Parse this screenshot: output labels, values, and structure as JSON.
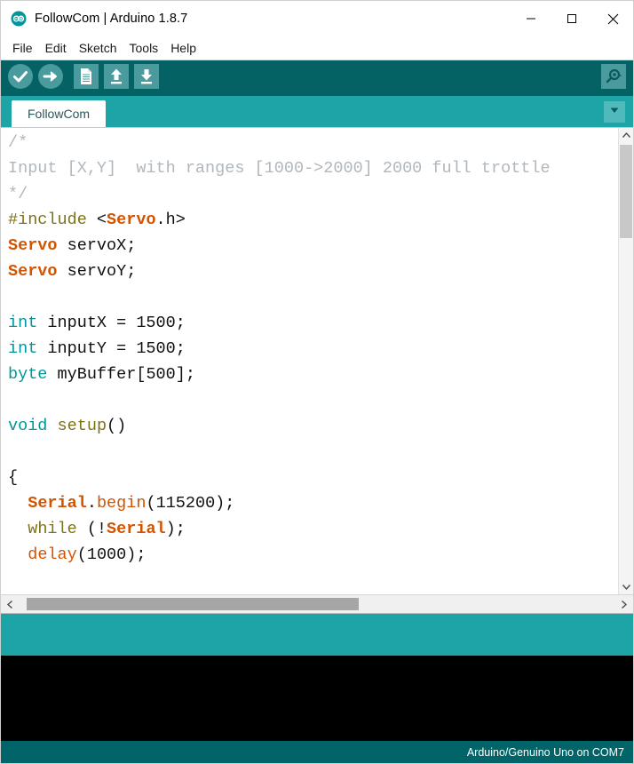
{
  "window": {
    "title": "FollowCom | Arduino 1.8.7",
    "logo_icon": "arduino-logo-icon",
    "minimize_icon": "minimize-icon",
    "maximize_icon": "maximize-icon",
    "close_icon": "close-icon"
  },
  "menubar": {
    "items": [
      {
        "label": "File"
      },
      {
        "label": "Edit"
      },
      {
        "label": "Sketch"
      },
      {
        "label": "Tools"
      },
      {
        "label": "Help"
      }
    ]
  },
  "toolbar": {
    "buttons": [
      {
        "name": "verify-button",
        "icon": "checkmark-circle-icon",
        "tooltip": "Verify"
      },
      {
        "name": "upload-button",
        "icon": "arrow-right-circle-icon",
        "tooltip": "Upload"
      },
      {
        "name": "new-button",
        "icon": "new-document-icon",
        "tooltip": "New"
      },
      {
        "name": "open-button",
        "icon": "arrow-up-icon",
        "tooltip": "Open"
      },
      {
        "name": "save-button",
        "icon": "arrow-down-icon",
        "tooltip": "Save"
      }
    ],
    "serial_monitor": {
      "icon": "magnifier-icon",
      "tooltip": "Serial Monitor"
    },
    "background_color": "#046264"
  },
  "tabbar": {
    "tabs": [
      {
        "label": "FollowCom",
        "active": true
      }
    ],
    "menu_icon": "chevron-down-icon",
    "background_color": "#1CA4A6"
  },
  "editor": {
    "lines": [
      [
        {
          "t": "/*",
          "c": "comment"
        }
      ],
      [
        {
          "t": "Input [X,Y]  with ranges [1000->2000] 2000 full trottle",
          "c": "comment"
        }
      ],
      [
        {
          "t": "*/",
          "c": "comment"
        }
      ],
      [
        {
          "t": "#include ",
          "c": "pre"
        },
        {
          "t": "<",
          "c": "plain"
        },
        {
          "t": "Servo",
          "c": "class"
        },
        {
          "t": ".h>",
          "c": "plain"
        }
      ],
      [
        {
          "t": "Servo",
          "c": "class"
        },
        {
          "t": " servoX;",
          "c": "plain"
        }
      ],
      [
        {
          "t": "Servo",
          "c": "class"
        },
        {
          "t": " servoY;",
          "c": "plain"
        }
      ],
      [
        {
          "t": "",
          "c": "plain"
        }
      ],
      [
        {
          "t": "int",
          "c": "type"
        },
        {
          "t": " inputX = 1500;",
          "c": "plain"
        }
      ],
      [
        {
          "t": "int",
          "c": "type"
        },
        {
          "t": " inputY = 1500;",
          "c": "plain"
        }
      ],
      [
        {
          "t": "byte",
          "c": "type"
        },
        {
          "t": " myBuffer[500];",
          "c": "plain"
        }
      ],
      [
        {
          "t": "",
          "c": "plain"
        }
      ],
      [
        {
          "t": "void",
          "c": "type"
        },
        {
          "t": " ",
          "c": "plain"
        },
        {
          "t": "setup",
          "c": "key"
        },
        {
          "t": "()",
          "c": "plain"
        }
      ],
      [
        {
          "t": "",
          "c": "plain"
        }
      ],
      [
        {
          "t": "{",
          "c": "plain"
        }
      ],
      [
        {
          "t": "  ",
          "c": "plain"
        },
        {
          "t": "Serial",
          "c": "class"
        },
        {
          "t": ".",
          "c": "plain"
        },
        {
          "t": "begin",
          "c": "func"
        },
        {
          "t": "(115200);",
          "c": "plain"
        }
      ],
      [
        {
          "t": "  ",
          "c": "plain"
        },
        {
          "t": "while",
          "c": "key"
        },
        {
          "t": " (!",
          "c": "plain"
        },
        {
          "t": "Serial",
          "c": "class"
        },
        {
          "t": ");",
          "c": "plain"
        }
      ],
      [
        {
          "t": "  ",
          "c": "plain"
        },
        {
          "t": "delay",
          "c": "func"
        },
        {
          "t": "(1000);",
          "c": "plain"
        }
      ]
    ],
    "vscroll": {
      "up_icon": "chevron-up-icon",
      "down_icon": "chevron-down-icon"
    },
    "hscroll": {
      "left_icon": "chevron-left-icon",
      "right_icon": "chevron-right-icon"
    }
  },
  "console": {
    "text": "",
    "background_color": "#000000"
  },
  "boardbar": {
    "text": "Arduino/Genuino Uno on COM7",
    "background_color": "#006468"
  }
}
